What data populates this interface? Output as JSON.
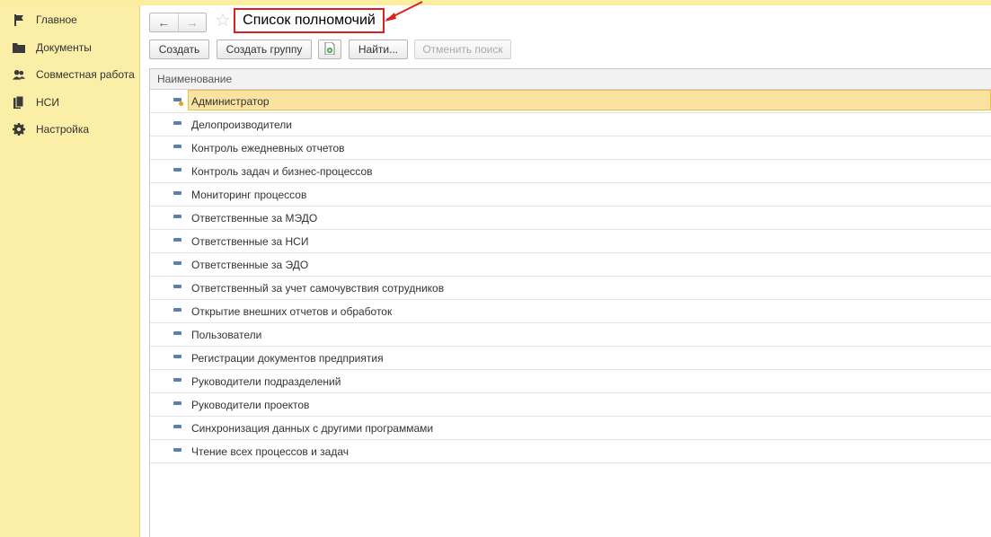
{
  "sidebar": {
    "items": [
      {
        "label": "Главное",
        "icon": "flag-icon"
      },
      {
        "label": "Документы",
        "icon": "folder-icon"
      },
      {
        "label": "Совместная работа",
        "icon": "users-icon"
      },
      {
        "label": "НСИ",
        "icon": "books-icon"
      },
      {
        "label": "Настройка",
        "icon": "gear-icon"
      }
    ]
  },
  "header": {
    "title": "Список полномочий",
    "back_icon": "arrow-left-icon",
    "forward_icon": "arrow-right-icon",
    "favorite_icon": "star-icon"
  },
  "toolbar": {
    "create_label": "Создать",
    "create_group_label": "Создать группу",
    "find_label": "Найти...",
    "cancel_search_label": "Отменить поиск"
  },
  "table": {
    "column_header": "Наименование",
    "rows": [
      "Администратор",
      "Делопроизводители",
      "Контроль ежедневных отчетов",
      "Контроль задач и бизнес-процессов",
      "Мониторинг процессов",
      "Ответственные за МЭДО",
      "Ответственные за НСИ",
      "Ответственные за ЭДО",
      "Ответственный за учет самочувствия сотрудников",
      "Открытие внешних отчетов и обработок",
      "Пользователи",
      "Регистрации документов предприятия",
      "Руководители подразделений",
      "Руководители проектов",
      "Синхронизация данных с другими программами",
      "Чтение всех процессов и задач"
    ],
    "selected_index": 0
  },
  "colors": {
    "sidebar_bg": "#fbeea7",
    "selection_bg": "#fae2a0",
    "highlight_border": "#d9221c"
  }
}
